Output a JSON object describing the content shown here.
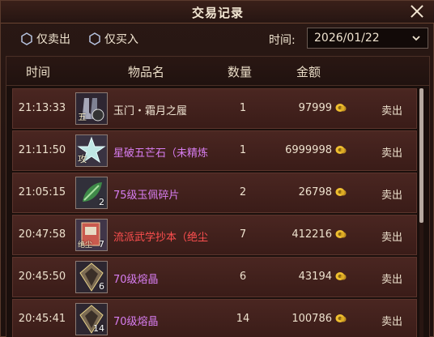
{
  "window": {
    "title": "交易记录"
  },
  "filters": {
    "only_sell": "仅卖出",
    "only_buy": "仅买入",
    "time_label": "时间:",
    "date_value": "2026/01/22"
  },
  "table": {
    "headers": {
      "time": "时间",
      "name": "物品名",
      "qty": "数量",
      "gold": "金额"
    },
    "rows": [
      {
        "time": "21:13:33",
        "name": "玉门・霜月之履",
        "qty": "1",
        "gold": "97999",
        "type": "卖出",
        "name_color": "#f1e6d4",
        "icon": "boots-icon",
        "icon_badge": "五",
        "count": ""
      },
      {
        "time": "21:11:50",
        "name": "星破五芒石（未精炼",
        "qty": "1",
        "gold": "6999998",
        "type": "卖出",
        "name_color": "#d77df0",
        "icon": "star-gem-icon",
        "icon_badge": "攻",
        "count": ""
      },
      {
        "time": "21:05:15",
        "name": "75级玉佩碎片",
        "qty": "2",
        "gold": "26798",
        "type": "卖出",
        "name_color": "#d77df0",
        "icon": "jade-leaf-icon",
        "icon_badge": "",
        "count": "2"
      },
      {
        "time": "20:47:58",
        "name": "流派武学抄本（绝尘",
        "qty": "7",
        "gold": "412216",
        "type": "卖出",
        "name_color": "#ff4f4f",
        "icon": "book-icon",
        "icon_badge": "绝尘",
        "count": "7"
      },
      {
        "time": "20:45:50",
        "name": "70级熔晶",
        "qty": "6",
        "gold": "43194",
        "type": "卖出",
        "name_color": "#d77df0",
        "icon": "crystal-icon",
        "icon_badge": "",
        "count": "6"
      },
      {
        "time": "20:45:41",
        "name": "70级熔晶",
        "qty": "14",
        "gold": "100786",
        "type": "卖出",
        "name_color": "#d77df0",
        "icon": "crystal-icon",
        "icon_badge": "",
        "count": "14"
      }
    ]
  },
  "colors": {
    "purple_item": "#d77df0",
    "red_item": "#ff4f4f",
    "coin": "#f0c030",
    "row_bg": "#4a2621"
  }
}
